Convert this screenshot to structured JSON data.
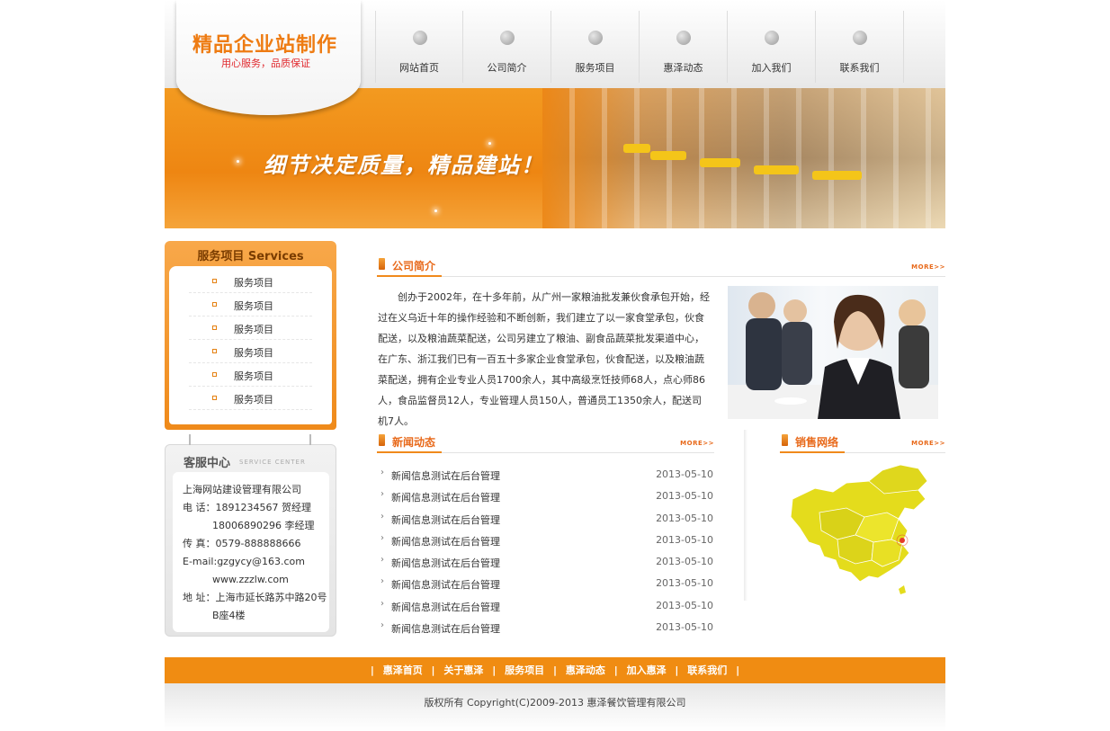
{
  "header": {
    "logo_title": "精品企业站制作",
    "logo_subtitle": "用心服务，品质保证",
    "nav": [
      "网站首页",
      "公司简介",
      "服务项目",
      "惠泽动态",
      "加入我们",
      "联系我们"
    ]
  },
  "banner": {
    "slogan": "细节决定质量，精品建站！"
  },
  "services": {
    "title": "服务项目 Services",
    "items": [
      "服务项目",
      "服务项目",
      "服务项目",
      "服务项目",
      "服务项目",
      "服务项目"
    ]
  },
  "customer_service": {
    "title": "客服中心",
    "title_en": "SERVICE CENTER",
    "lines": [
      "上海网站建设管理有限公司",
      "电 话：1891234567 贺经理",
      "　　　18006890296 李经理",
      "传 真：0579-888888666",
      "E-mail:gzgycy@163.com",
      "　　　www.zzzlw.com",
      "地 址：上海市延长路苏中路20号",
      "　　　B座4楼"
    ]
  },
  "about": {
    "title": "公司简介",
    "more": "MORE>>",
    "text": "创办于2002年，在十多年前，从广州一家粮油批发兼伙食承包开始，经过在义乌近十年的操作经验和不断创新，我们建立了以一家食堂承包，伙食配送，以及粮油蔬菜配送，公司另建立了粮油、副食品蔬菜批发渠道中心，在广东、浙江我们已有一百五十多家企业食堂承包，伙食配送，以及粮油蔬菜配送，拥有企业专业人员1700余人，其中高级烹饪技师68人，点心师86人，食品监督员12人，专业管理人员150人，普通员工1350余人，配送司机7人。"
  },
  "news": {
    "title": "新闻动态",
    "more": "MORE>>",
    "items": [
      {
        "title": "新闻信息测试在后台管理",
        "date": "2013-05-10"
      },
      {
        "title": "新闻信息测试在后台管理",
        "date": "2013-05-10"
      },
      {
        "title": "新闻信息测试在后台管理",
        "date": "2013-05-10"
      },
      {
        "title": "新闻信息测试在后台管理",
        "date": "2013-05-10"
      },
      {
        "title": "新闻信息测试在后台管理",
        "date": "2013-05-10"
      },
      {
        "title": "新闻信息测试在后台管理",
        "date": "2013-05-10"
      },
      {
        "title": "新闻信息测试在后台管理",
        "date": "2013-05-10"
      },
      {
        "title": "新闻信息测试在后台管理",
        "date": "2013-05-10"
      }
    ]
  },
  "sales": {
    "title": "销售网络",
    "more": "MORE>>"
  },
  "footer": {
    "nav": [
      "惠泽首页",
      "关于惠泽",
      "服务项目",
      "惠泽动态",
      "加入惠泽",
      "联系我们"
    ],
    "separator": "|",
    "copyright": "版权所有 Copyright(C)2009-2013 惠泽餐饮管理有限公司"
  },
  "colors": {
    "accent": "#f08c12",
    "title_orange": "#e8691a",
    "map_yellow": "#e6e01e"
  }
}
